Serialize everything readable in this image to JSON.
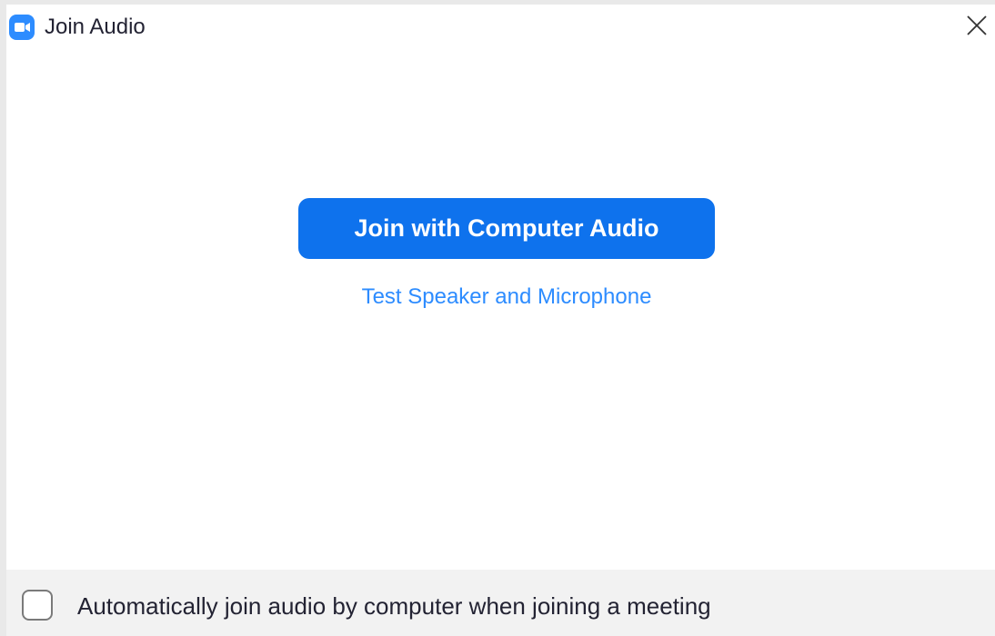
{
  "window": {
    "title": "Join Audio",
    "app_icon": "zoom-camera-icon",
    "close_icon": "close-icon"
  },
  "main": {
    "primary_button_label": "Join with Computer Audio",
    "test_link_label": "Test Speaker and Microphone"
  },
  "footer": {
    "auto_join_label": "Automatically join audio by computer when joining a meeting",
    "auto_join_checked": false
  },
  "colors": {
    "accent": "#0e72ed",
    "link": "#2d8cff",
    "footer_bg": "#f2f2f2"
  }
}
